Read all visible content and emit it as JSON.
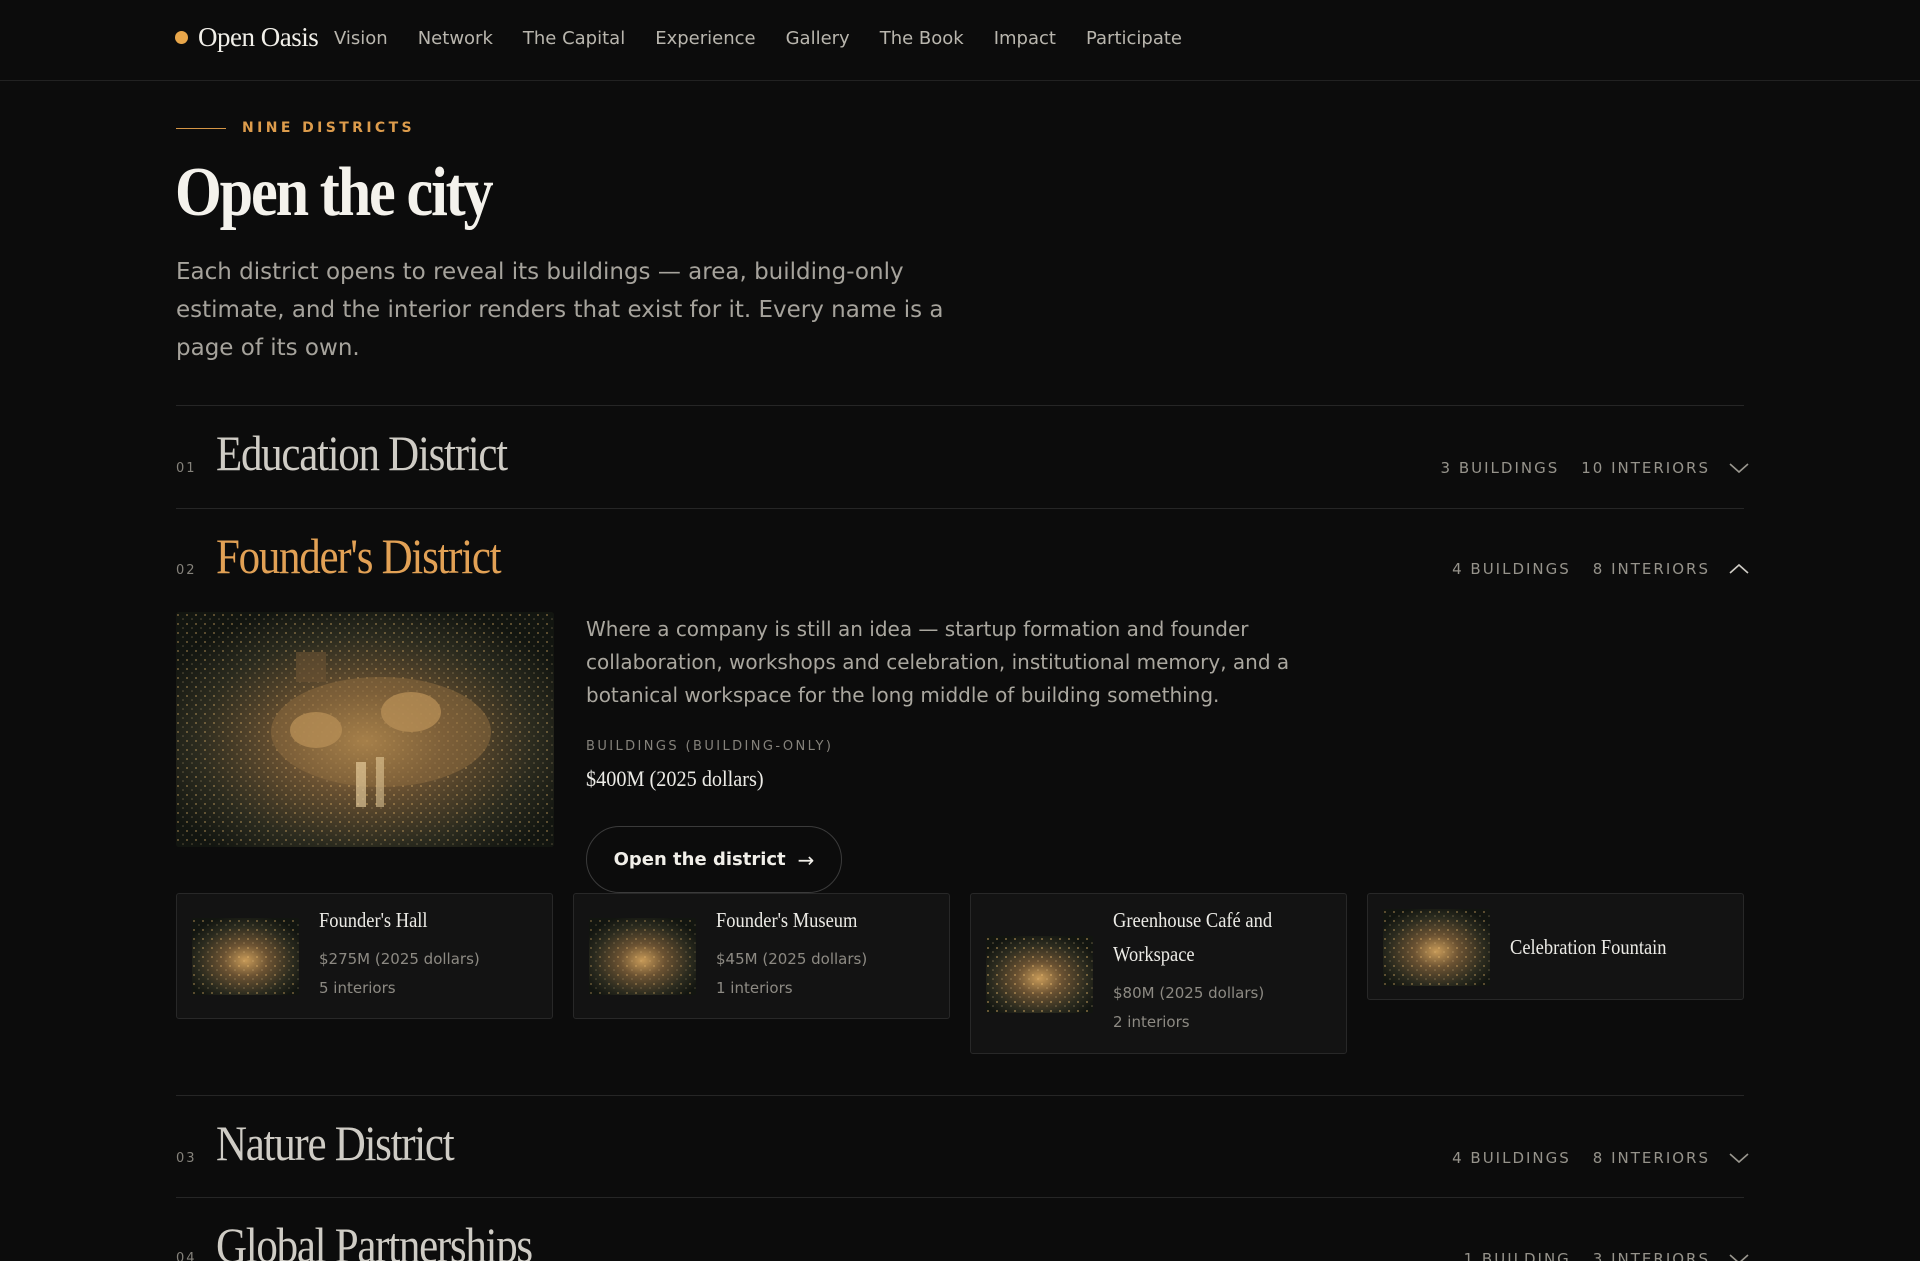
{
  "nav": {
    "brand": "Open Oasis",
    "links": [
      "Vision",
      "Network",
      "The Capital",
      "Experience",
      "Gallery",
      "The Book",
      "Impact",
      "Participate"
    ]
  },
  "hero": {
    "eyebrow": "NINE DISTRICTS",
    "title": "Open the city",
    "intro": "Each district opens to reveal its buildings — area, building-only estimate, and the interior renders that exist for it. Every name is a page of its own."
  },
  "districts": [
    {
      "num": "01",
      "name": "Education District",
      "buildings": "3 BUILDINGS",
      "interiors": "10 INTERIORS"
    },
    {
      "num": "02",
      "name": "Founder's District",
      "buildings": "4 BUILDINGS",
      "interiors": "8 INTERIORS"
    },
    {
      "num": "03",
      "name": "Nature District",
      "buildings": "4 BUILDINGS",
      "interiors": "8 INTERIORS"
    },
    {
      "num": "04",
      "name": "Global Partnerships",
      "buildings": "1 BUILDING",
      "interiors": "3 INTERIORS"
    }
  ],
  "expanded": {
    "description": "Where a company is still an idea — startup formation and founder collaboration, workshops and celebration, institutional memory, and a botanical workspace for the long middle of building something.",
    "estimate_label": "BUILDINGS (BUILDING-ONLY)",
    "estimate_value": "$400M (2025 dollars)",
    "open_button": "Open the district",
    "open_button_arrow": "→",
    "buildings": [
      {
        "title": "Founder's Hall",
        "price": "$275M (2025 dollars)",
        "interiors": "5 interiors"
      },
      {
        "title": "Founder's Museum",
        "price": "$45M (2025 dollars)",
        "interiors": "1 interiors"
      },
      {
        "title": "Greenhouse Café and Workspace",
        "price": "$80M (2025 dollars)",
        "interiors": "2 interiors"
      },
      {
        "title": "Celebration Fountain"
      }
    ]
  },
  "colors": {
    "background": "#0c0c0c",
    "accent": "#e2a155",
    "text": "#ecebe6",
    "muted": "#96938b"
  },
  "icons": {
    "collapsed": "chevron-down-icon",
    "expanded": "chevron-up-icon"
  }
}
